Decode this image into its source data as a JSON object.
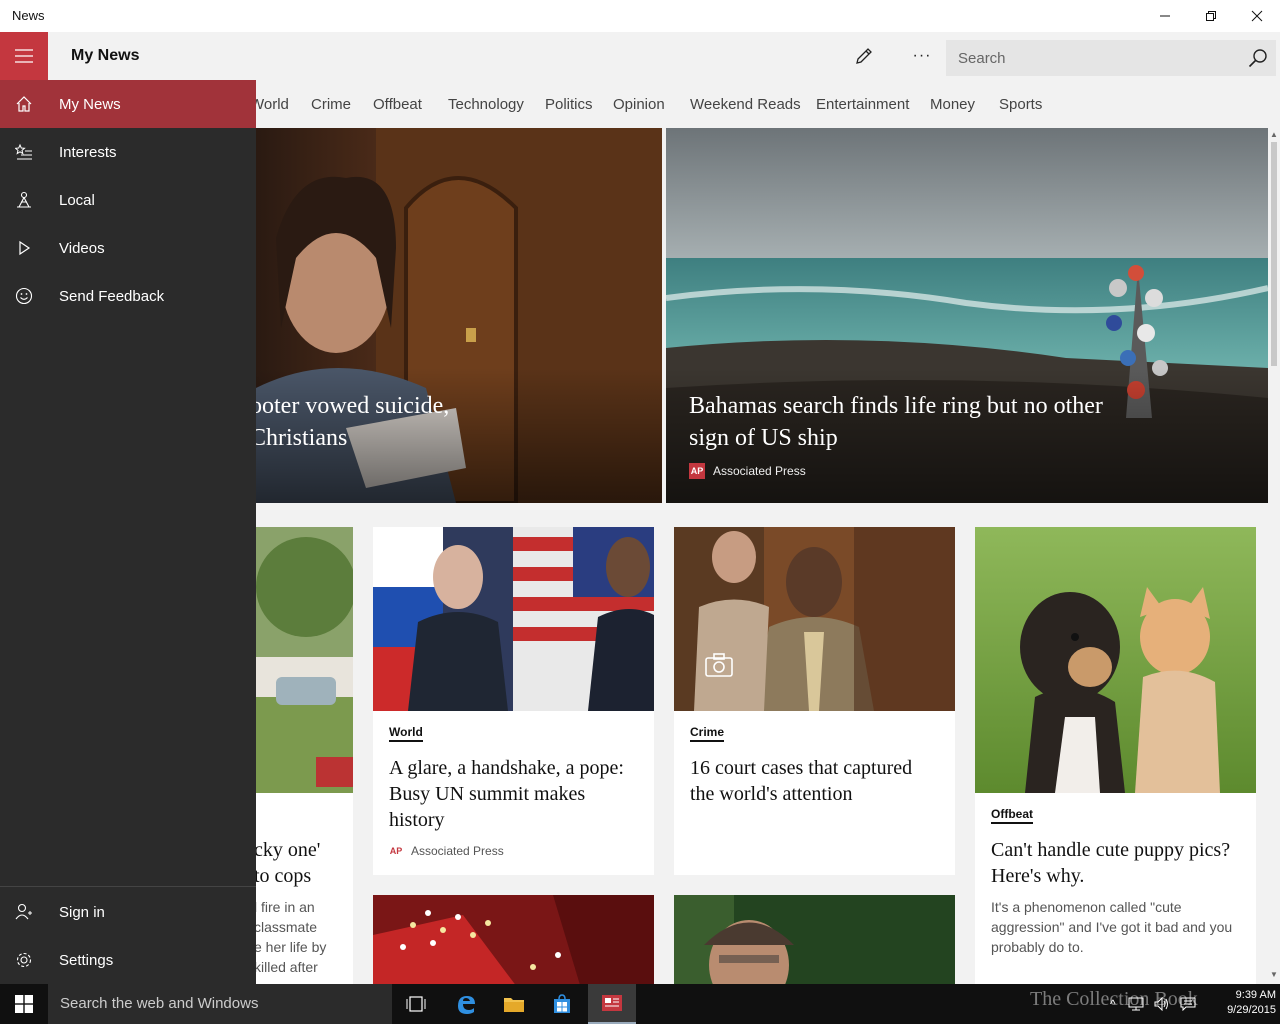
{
  "window": {
    "title": "News"
  },
  "header": {
    "title": "My News",
    "search_placeholder": "Search",
    "more_label": "···"
  },
  "tabs": [
    "World",
    "Crime",
    "Offbeat",
    "Technology",
    "Politics",
    "Opinion",
    "Weekend Reads",
    "Entertainment",
    "Money",
    "Sports"
  ],
  "nav": {
    "items": [
      {
        "label": "My News",
        "icon": "home-icon",
        "active": true
      },
      {
        "label": "Interests",
        "icon": "star-list-icon"
      },
      {
        "label": "Local",
        "icon": "local-icon"
      },
      {
        "label": "Videos",
        "icon": "play-icon"
      },
      {
        "label": "Send Feedback",
        "icon": "smiley-icon"
      }
    ],
    "bottom": [
      {
        "label": "Sign in",
        "icon": "person-add-icon"
      },
      {
        "label": "Settings",
        "icon": "gear-icon"
      }
    ]
  },
  "hero": [
    {
      "headline_line1": "ooter vowed suicide,",
      "headline_line2": "Christians"
    },
    {
      "headline": "Bahamas search finds life ring but no other sign of US ship",
      "source": "Associated Press",
      "source_logo": "AP"
    }
  ],
  "cards": [
    {
      "title_line1": "cky one'",
      "title_line2": "to cops",
      "blurb": [
        "l fire in an",
        "classmate",
        "e her life by",
        "killed after"
      ]
    },
    {
      "category": "World",
      "title": "A glare, a handshake, a pope: Busy UN summit makes history",
      "source": "Associated Press",
      "source_logo": "AP"
    },
    {
      "category": "Crime",
      "title": "16 court cases that captured the world's attention",
      "badge_icon": "camera-icon"
    },
    {
      "category": "Offbeat",
      "title": "Can't handle cute puppy pics? Here's why.",
      "blurb": "It's a phenomenon called \"cute aggression\" and I've got it bad and you probably do to."
    }
  ],
  "taskbar": {
    "search_placeholder": "Search the web and Windows",
    "time": "9:39 AM",
    "date": "9/29/2015",
    "watermark": "The Collection Book"
  },
  "colors": {
    "accent": "#c4373f",
    "nav_bg": "#2b2b2b",
    "nav_active": "#a1333a"
  }
}
